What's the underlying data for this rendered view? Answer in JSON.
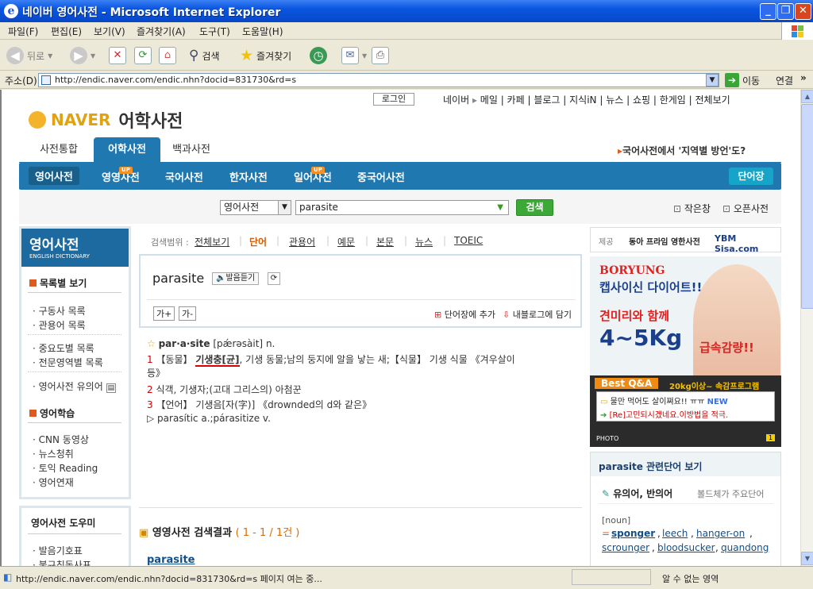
{
  "window": {
    "title": "네이버 영어사전 - Microsoft Internet Explorer"
  },
  "menu": [
    "파일(F)",
    "편집(E)",
    "보기(V)",
    "즐겨찾기(A)",
    "도구(T)",
    "도움말(H)"
  ],
  "toolbar": {
    "back": "뒤로",
    "search": "검색",
    "favorites": "즐겨찾기"
  },
  "address": {
    "label": "주소(D)",
    "url": "http://endic.naver.com/endic.nhn?docid=831730&rd=s",
    "go": "이동",
    "links": "연결"
  },
  "status": {
    "text": "http://endic.naver.com/endic.nhn?docid=831730&rd=s 페이지 여는 중...",
    "zone": "알 수 없는 영역"
  },
  "page": {
    "login": "로그인",
    "topnav": [
      "네이버",
      "메일",
      "카페",
      "블로그",
      "지식iN",
      "뉴스",
      "쇼핑",
      "한게임",
      "전체보기"
    ],
    "logo": {
      "brand": "NAVER",
      "title": "어학사전"
    },
    "tabs": [
      "사전통합",
      "어학사전",
      "백과사전"
    ],
    "promo": "국어사전에서 '지역별 방언'도?",
    "subnav": [
      "영어사전",
      "영영사전",
      "국어사전",
      "한자사전",
      "일어사전",
      "중국어사전"
    ],
    "up_badge": "UP",
    "wordbook": "단어장",
    "search": {
      "dict": "영어사전",
      "query": "parasite",
      "button": "검색",
      "mini": "작은창",
      "open": "오픈사전"
    },
    "sidebar": {
      "title": "영어사전",
      "subtitle": "ENGLISH DICTIONARY",
      "sec1": "목록별 보기",
      "items1": [
        "구동사 목록",
        "관용어 목록"
      ],
      "items2": [
        "중요도별 목록",
        "전문영역별 목록"
      ],
      "items3": [
        "영어사전 유의어"
      ],
      "sec2": "영어학습",
      "items4": [
        "CNN 동영상",
        "뉴스청취",
        "토익 Reading",
        "영어연재"
      ],
      "help": "영어사전 도우미",
      "items5": [
        "발음기호표",
        "불규칙동사표"
      ]
    },
    "range": {
      "label": "검색범위 :",
      "tabs": [
        "전체보기",
        "단어",
        "관용어",
        "예문",
        "본문",
        "뉴스",
        "TOEIC"
      ]
    },
    "entry": {
      "word": "parasite",
      "listen": "발음듣기",
      "font_up": "가+",
      "font_down": "가-",
      "add": "단어장에 추가",
      "blog": "내블로그에 담기",
      "headword": "par·a·site",
      "pron": "[pǽrəsàit]",
      "pos": "n.",
      "d1a": "1",
      "d1b": "【동물】",
      "d1c": "기생충[균]",
      "d1d": ", 기생 동물;남의 둥지에 알을 낳는 새;【식물】 기생 식물 《겨우살이",
      "d1e": "등》",
      "d2a": "2",
      "d2b": "식객, 기생자;(고대 그리스의) 아첨꾼",
      "d3a": "3",
      "d3b": "【언어】 기생음[자(字)] 《drownded의 d와 같은》",
      "derived": "▷ parasític a.;párasitize v."
    },
    "ee": {
      "title": "영영사전 검색결과",
      "count": "( 1 - 1 / 1건 )",
      "word": "parasite"
    },
    "provider": {
      "label": "제공",
      "donga": "동아 프라임 영한사전",
      "ybm": "YBM Sisa.com"
    },
    "ad": {
      "brand": "BORYUNG",
      "line1": "캡사이신 다이어트!!",
      "line2": "견미리와 함께",
      "line3": "4~5Kg",
      "line4": "급속감량!!",
      "qa": "Best Q&A",
      "qa_sub": "20kg이상~ 속감프로그램",
      "q1": "물만 먹어도 살이쪄요!! ㅠㅠ",
      "new": "NEW",
      "q2": "[Re]고민되시겠네요.이방법을 적극.",
      "photo": "PHOTO",
      "page": "1"
    },
    "related": {
      "title": "parasite 관련단어 보기",
      "syn": "유의어, 반의어",
      "more": "볼드체가 주요단어",
      "tag": "[noun]",
      "words": [
        "sponger",
        "leech",
        "hanger-on",
        "scrounger",
        "bloodsucker",
        "quandong"
      ]
    }
  }
}
